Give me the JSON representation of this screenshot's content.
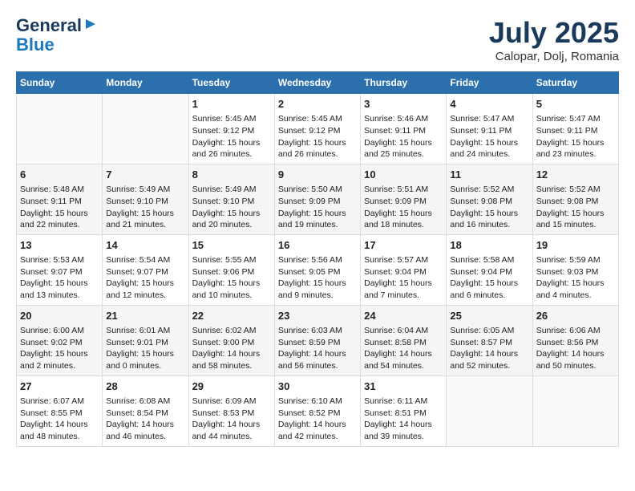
{
  "logo": {
    "line1": "General",
    "line2": "Blue"
  },
  "title": "July 2025",
  "location": "Calopar, Dolj, Romania",
  "headers": [
    "Sunday",
    "Monday",
    "Tuesday",
    "Wednesday",
    "Thursday",
    "Friday",
    "Saturday"
  ],
  "weeks": [
    [
      {
        "day": "",
        "info": ""
      },
      {
        "day": "",
        "info": ""
      },
      {
        "day": "1",
        "info": "Sunrise: 5:45 AM\nSunset: 9:12 PM\nDaylight: 15 hours and 26 minutes."
      },
      {
        "day": "2",
        "info": "Sunrise: 5:45 AM\nSunset: 9:12 PM\nDaylight: 15 hours and 26 minutes."
      },
      {
        "day": "3",
        "info": "Sunrise: 5:46 AM\nSunset: 9:11 PM\nDaylight: 15 hours and 25 minutes."
      },
      {
        "day": "4",
        "info": "Sunrise: 5:47 AM\nSunset: 9:11 PM\nDaylight: 15 hours and 24 minutes."
      },
      {
        "day": "5",
        "info": "Sunrise: 5:47 AM\nSunset: 9:11 PM\nDaylight: 15 hours and 23 minutes."
      }
    ],
    [
      {
        "day": "6",
        "info": "Sunrise: 5:48 AM\nSunset: 9:11 PM\nDaylight: 15 hours and 22 minutes."
      },
      {
        "day": "7",
        "info": "Sunrise: 5:49 AM\nSunset: 9:10 PM\nDaylight: 15 hours and 21 minutes."
      },
      {
        "day": "8",
        "info": "Sunrise: 5:49 AM\nSunset: 9:10 PM\nDaylight: 15 hours and 20 minutes."
      },
      {
        "day": "9",
        "info": "Sunrise: 5:50 AM\nSunset: 9:09 PM\nDaylight: 15 hours and 19 minutes."
      },
      {
        "day": "10",
        "info": "Sunrise: 5:51 AM\nSunset: 9:09 PM\nDaylight: 15 hours and 18 minutes."
      },
      {
        "day": "11",
        "info": "Sunrise: 5:52 AM\nSunset: 9:08 PM\nDaylight: 15 hours and 16 minutes."
      },
      {
        "day": "12",
        "info": "Sunrise: 5:52 AM\nSunset: 9:08 PM\nDaylight: 15 hours and 15 minutes."
      }
    ],
    [
      {
        "day": "13",
        "info": "Sunrise: 5:53 AM\nSunset: 9:07 PM\nDaylight: 15 hours and 13 minutes."
      },
      {
        "day": "14",
        "info": "Sunrise: 5:54 AM\nSunset: 9:07 PM\nDaylight: 15 hours and 12 minutes."
      },
      {
        "day": "15",
        "info": "Sunrise: 5:55 AM\nSunset: 9:06 PM\nDaylight: 15 hours and 10 minutes."
      },
      {
        "day": "16",
        "info": "Sunrise: 5:56 AM\nSunset: 9:05 PM\nDaylight: 15 hours and 9 minutes."
      },
      {
        "day": "17",
        "info": "Sunrise: 5:57 AM\nSunset: 9:04 PM\nDaylight: 15 hours and 7 minutes."
      },
      {
        "day": "18",
        "info": "Sunrise: 5:58 AM\nSunset: 9:04 PM\nDaylight: 15 hours and 6 minutes."
      },
      {
        "day": "19",
        "info": "Sunrise: 5:59 AM\nSunset: 9:03 PM\nDaylight: 15 hours and 4 minutes."
      }
    ],
    [
      {
        "day": "20",
        "info": "Sunrise: 6:00 AM\nSunset: 9:02 PM\nDaylight: 15 hours and 2 minutes."
      },
      {
        "day": "21",
        "info": "Sunrise: 6:01 AM\nSunset: 9:01 PM\nDaylight: 15 hours and 0 minutes."
      },
      {
        "day": "22",
        "info": "Sunrise: 6:02 AM\nSunset: 9:00 PM\nDaylight: 14 hours and 58 minutes."
      },
      {
        "day": "23",
        "info": "Sunrise: 6:03 AM\nSunset: 8:59 PM\nDaylight: 14 hours and 56 minutes."
      },
      {
        "day": "24",
        "info": "Sunrise: 6:04 AM\nSunset: 8:58 PM\nDaylight: 14 hours and 54 minutes."
      },
      {
        "day": "25",
        "info": "Sunrise: 6:05 AM\nSunset: 8:57 PM\nDaylight: 14 hours and 52 minutes."
      },
      {
        "day": "26",
        "info": "Sunrise: 6:06 AM\nSunset: 8:56 PM\nDaylight: 14 hours and 50 minutes."
      }
    ],
    [
      {
        "day": "27",
        "info": "Sunrise: 6:07 AM\nSunset: 8:55 PM\nDaylight: 14 hours and 48 minutes."
      },
      {
        "day": "28",
        "info": "Sunrise: 6:08 AM\nSunset: 8:54 PM\nDaylight: 14 hours and 46 minutes."
      },
      {
        "day": "29",
        "info": "Sunrise: 6:09 AM\nSunset: 8:53 PM\nDaylight: 14 hours and 44 minutes."
      },
      {
        "day": "30",
        "info": "Sunrise: 6:10 AM\nSunset: 8:52 PM\nDaylight: 14 hours and 42 minutes."
      },
      {
        "day": "31",
        "info": "Sunrise: 6:11 AM\nSunset: 8:51 PM\nDaylight: 14 hours and 39 minutes."
      },
      {
        "day": "",
        "info": ""
      },
      {
        "day": "",
        "info": ""
      }
    ]
  ]
}
